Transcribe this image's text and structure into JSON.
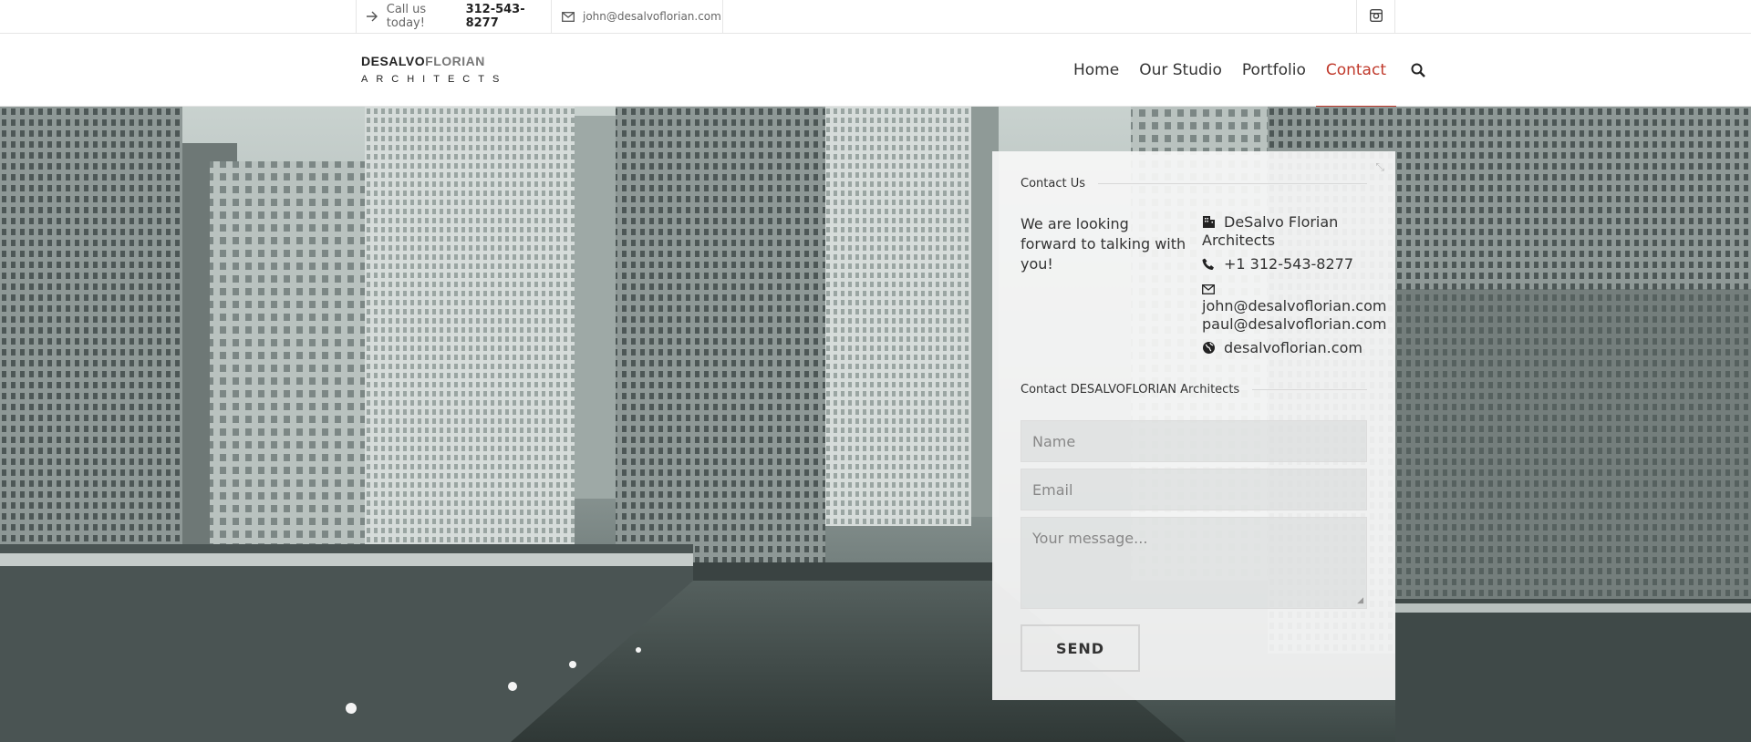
{
  "topbar": {
    "call_label": "Call us today!",
    "call_phone": "312-543-8277",
    "email": "john@desalvoflorian.com",
    "icons": {
      "call": "arrow-right-icon",
      "email": "envelope-icon",
      "social": "instagram-icon"
    }
  },
  "header": {
    "logo_bold": "DESALVO",
    "logo_light": "FLORIAN",
    "logo_sub": "ARCHITECTS",
    "nav": [
      {
        "label": "Home",
        "active": false
      },
      {
        "label": "Our Studio",
        "active": false
      },
      {
        "label": "Portfolio",
        "active": false
      },
      {
        "label": "Contact",
        "active": true
      }
    ],
    "search_icon": "search-icon",
    "accent_color": "#c0392b"
  },
  "contact": {
    "section_title": "Contact Us",
    "intro": "We are looking forward to talking with you!",
    "company": "DeSalvo Florian Architects",
    "phone": "+1 312-543-8277",
    "email_1": "john@desalvoflorian.com",
    "email_2": "paul@desalvoflorian.com",
    "website": "desalvoflorian.com",
    "form_title": "Contact DESALVOFLORIAN Architects",
    "name_placeholder": "Name",
    "email_placeholder": "Email",
    "message_placeholder": "Your message...",
    "send_label": "SEND"
  }
}
